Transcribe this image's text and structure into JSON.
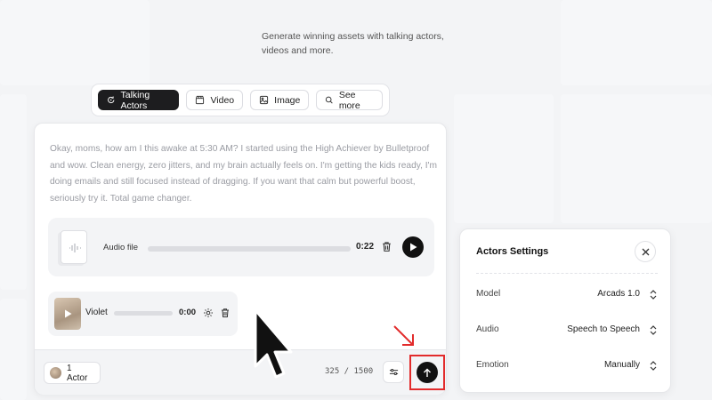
{
  "tagline": "Generate winning assets with talking actors, videos and more.",
  "tabs": [
    {
      "label": "Talking Actors",
      "icon": "sparkle-refresh-icon",
      "active": true
    },
    {
      "label": "Video",
      "icon": "clapperboard-icon",
      "active": false
    },
    {
      "label": "Image",
      "icon": "image-icon",
      "active": false
    },
    {
      "label": "See more",
      "icon": "search-icon",
      "active": false
    }
  ],
  "script_text": "Okay, moms, how am I this awake at 5:30 AM? I started using the High Achiever by Bulletproof and wow. Clean energy, zero jitters, and my brain actually feels on. I'm getting the kids ready, I'm doing emails and still focused instead of dragging. If you want that calm but powerful boost, seriously try it. Total game changer.",
  "audio": {
    "label": "Audio file",
    "time": "0:22",
    "progress": 0
  },
  "actor": {
    "name": "Violet",
    "time": "0:00",
    "progress": 0
  },
  "footer": {
    "actor_count": "1 Actor",
    "char_count": "325 / 1500"
  },
  "panel": {
    "title": "Actors Settings",
    "rows": [
      {
        "label": "Model",
        "value": "Arcads 1.0"
      },
      {
        "label": "Audio",
        "value": "Speech to Speech"
      },
      {
        "label": "Emotion",
        "value": "Manually"
      }
    ]
  },
  "colors": {
    "highlight": "#e22b2b",
    "primary": "#1d1d1f"
  }
}
